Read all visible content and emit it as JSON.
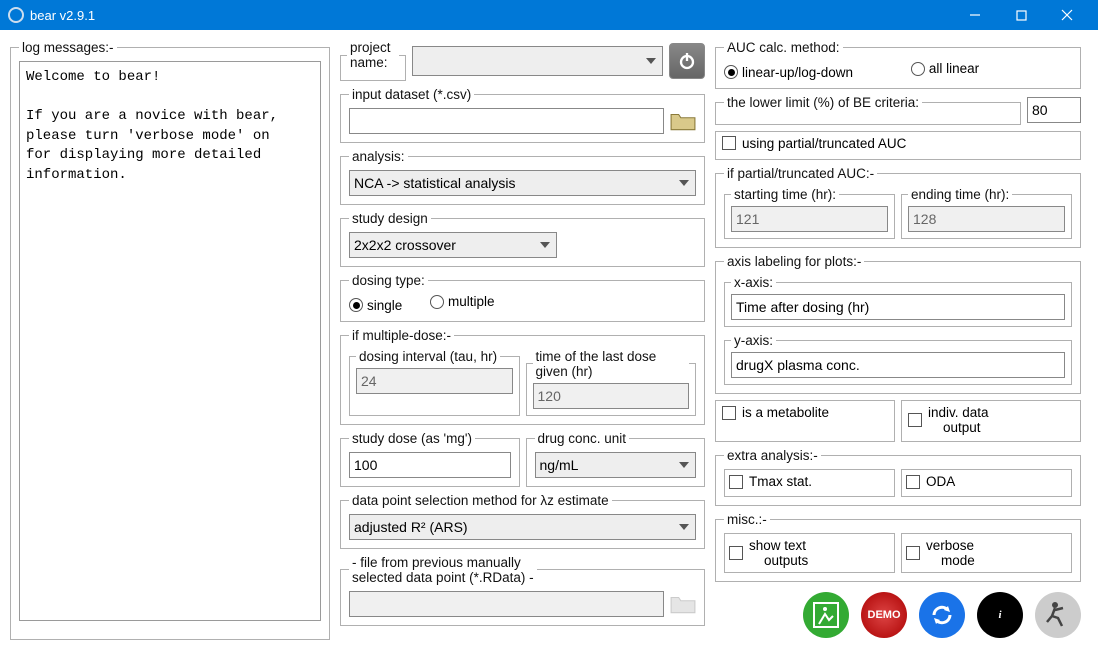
{
  "window": {
    "title": "bear v2.9.1"
  },
  "log": {
    "legend": "log messages:-",
    "text": "Welcome to bear!\n\nIf you are a novice with bear,\nplease turn 'verbose mode' on\nfor displaying more detailed\ninformation."
  },
  "project": {
    "legend": "project name:",
    "value": ""
  },
  "inputds": {
    "legend": "input dataset (*.csv)",
    "value": ""
  },
  "analysis": {
    "legend": "analysis:",
    "value": "NCA -> statistical analysis"
  },
  "design": {
    "legend": "study design",
    "value": "2x2x2 crossover"
  },
  "dosing": {
    "legend": "dosing type:",
    "single": "single",
    "multiple": "multiple"
  },
  "multidose": {
    "legend": "if multiple-dose:-",
    "interval_legend": "dosing interval (tau, hr)",
    "interval_value": "24",
    "lastdose_legend": "time of the last dose given (hr)",
    "lastdose_value": "120"
  },
  "studydose": {
    "legend": "study dose (as 'mg')",
    "value": "100"
  },
  "concunit": {
    "legend": "drug conc. unit",
    "value": "ng/mL"
  },
  "lambdaz": {
    "legend": "data point selection method for λz estimate",
    "value": "adjusted R² (ARS)"
  },
  "prevfile": {
    "legend": "- file from previously manually selected data point (*.RData) -",
    "legend1": "- file from previous manually",
    "legend2": "selected data point (*.RData) -",
    "value": ""
  },
  "auc": {
    "legend": "AUC calc. method:",
    "linlog": "linear-up/log-down",
    "linear": "all linear"
  },
  "belimit": {
    "legend": "the lower limit (%) of BE criteria:",
    "value": "80"
  },
  "partialauc_chk": {
    "label": "using partial/truncated AUC"
  },
  "partialauc": {
    "legend": "if partial/truncated AUC:-",
    "start_legend": "starting time (hr):",
    "start_value": "121",
    "end_legend": "ending time (hr):",
    "end_value": "128"
  },
  "axislabel": {
    "legend": "axis labeling for plots:-",
    "x_legend": "x-axis:",
    "x_value": "Time after dosing (hr)",
    "y_legend": "y-axis:",
    "y_value": "drugX plasma conc."
  },
  "metabolite": {
    "label": "is a metabolite"
  },
  "indivdata": {
    "label1": "indiv. data",
    "label2": "output"
  },
  "extra": {
    "legend": "extra analysis:-",
    "tmax": "Tmax stat.",
    "oda": "ODA"
  },
  "misc": {
    "legend": "misc.:-",
    "show1": "show text",
    "show2": "outputs",
    "verb1": "verbose",
    "verb2": "mode"
  },
  "demo_label": "DEMO"
}
